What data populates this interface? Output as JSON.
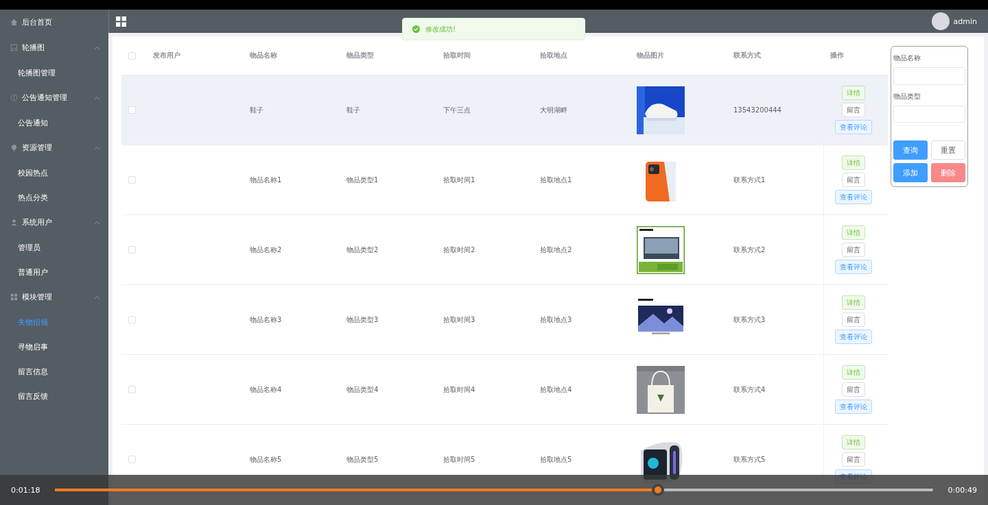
{
  "sidebar": {
    "items": [
      {
        "label": "后台首页"
      },
      {
        "label": "轮播图",
        "expanded": true,
        "children": [
          {
            "label": "轮播图管理",
            "selected": false
          }
        ]
      },
      {
        "label": "公告通知管理",
        "expanded": true,
        "children": [
          {
            "label": "公告通知",
            "selected": false
          }
        ]
      },
      {
        "label": "资源管理",
        "expanded": true,
        "children": [
          {
            "label": "校园热点",
            "selected": false
          },
          {
            "label": "热点分类",
            "selected": false
          }
        ]
      },
      {
        "label": "系统用户",
        "expanded": true,
        "children": [
          {
            "label": "管理员",
            "selected": false
          },
          {
            "label": "普通用户",
            "selected": false
          }
        ]
      },
      {
        "label": "模块管理",
        "expanded": true,
        "children": [
          {
            "label": "失物招领",
            "selected": true
          },
          {
            "label": "寻物启事",
            "selected": false
          },
          {
            "label": "留言信息",
            "selected": false
          },
          {
            "label": "留言反馈",
            "selected": false
          }
        ]
      }
    ]
  },
  "header": {
    "user": "admin"
  },
  "toast": {
    "message": "修改成功!"
  },
  "table": {
    "all_checked": false,
    "columns": [
      "发布用户",
      "物品名称",
      "物品类型",
      "拾取时间",
      "拾取地点",
      "物品图片",
      "联系方式",
      "操作"
    ],
    "rows": [
      {
        "checked": false,
        "highlighted": true,
        "name": "鞋子",
        "type": "鞋子",
        "time": "下午三点",
        "place": "大明湖畔",
        "contact": "13543200444",
        "actions": [
          "详情",
          "留言",
          "查看评论"
        ]
      },
      {
        "checked": false,
        "highlighted": false,
        "name": "物品名称1",
        "type": "物品类型1",
        "time": "拾取时间1",
        "place": "拾取地点1",
        "contact": "联系方式1",
        "actions": [
          "详情",
          "留言",
          "查看评论"
        ]
      },
      {
        "checked": false,
        "highlighted": false,
        "name": "物品名称2",
        "type": "物品类型2",
        "time": "拾取时间2",
        "place": "拾取地点2",
        "contact": "联系方式2",
        "actions": [
          "详情",
          "留言",
          "查看评论"
        ]
      },
      {
        "checked": false,
        "highlighted": false,
        "name": "物品名称3",
        "type": "物品类型3",
        "time": "拾取时间3",
        "place": "拾取地点3",
        "contact": "联系方式3",
        "actions": [
          "详情",
          "留言",
          "查看评论"
        ]
      },
      {
        "checked": false,
        "highlighted": false,
        "name": "物品名称4",
        "type": "物品类型4",
        "time": "拾取时间4",
        "place": "拾取地点4",
        "contact": "联系方式4",
        "actions": [
          "详情",
          "留言",
          "查看评论"
        ]
      },
      {
        "checked": false,
        "highlighted": false,
        "name": "物品名称5",
        "type": "物品类型5",
        "time": "拾取时间5",
        "place": "拾取地点5",
        "contact": "联系方式5",
        "actions": [
          "详情",
          "留言",
          "查看评论"
        ]
      }
    ]
  },
  "search": {
    "fields": [
      {
        "label": "物品名称"
      },
      {
        "label": "物品类型"
      }
    ],
    "buttons": [
      {
        "label": "查询",
        "kind": "primary"
      },
      {
        "label": "重置",
        "kind": "default"
      },
      {
        "label": "添加",
        "kind": "primary"
      },
      {
        "label": "删除",
        "kind": "danger"
      }
    ]
  },
  "player": {
    "elapsed": "0:01:18",
    "remaining": "0:00:49",
    "level": 0.687
  }
}
